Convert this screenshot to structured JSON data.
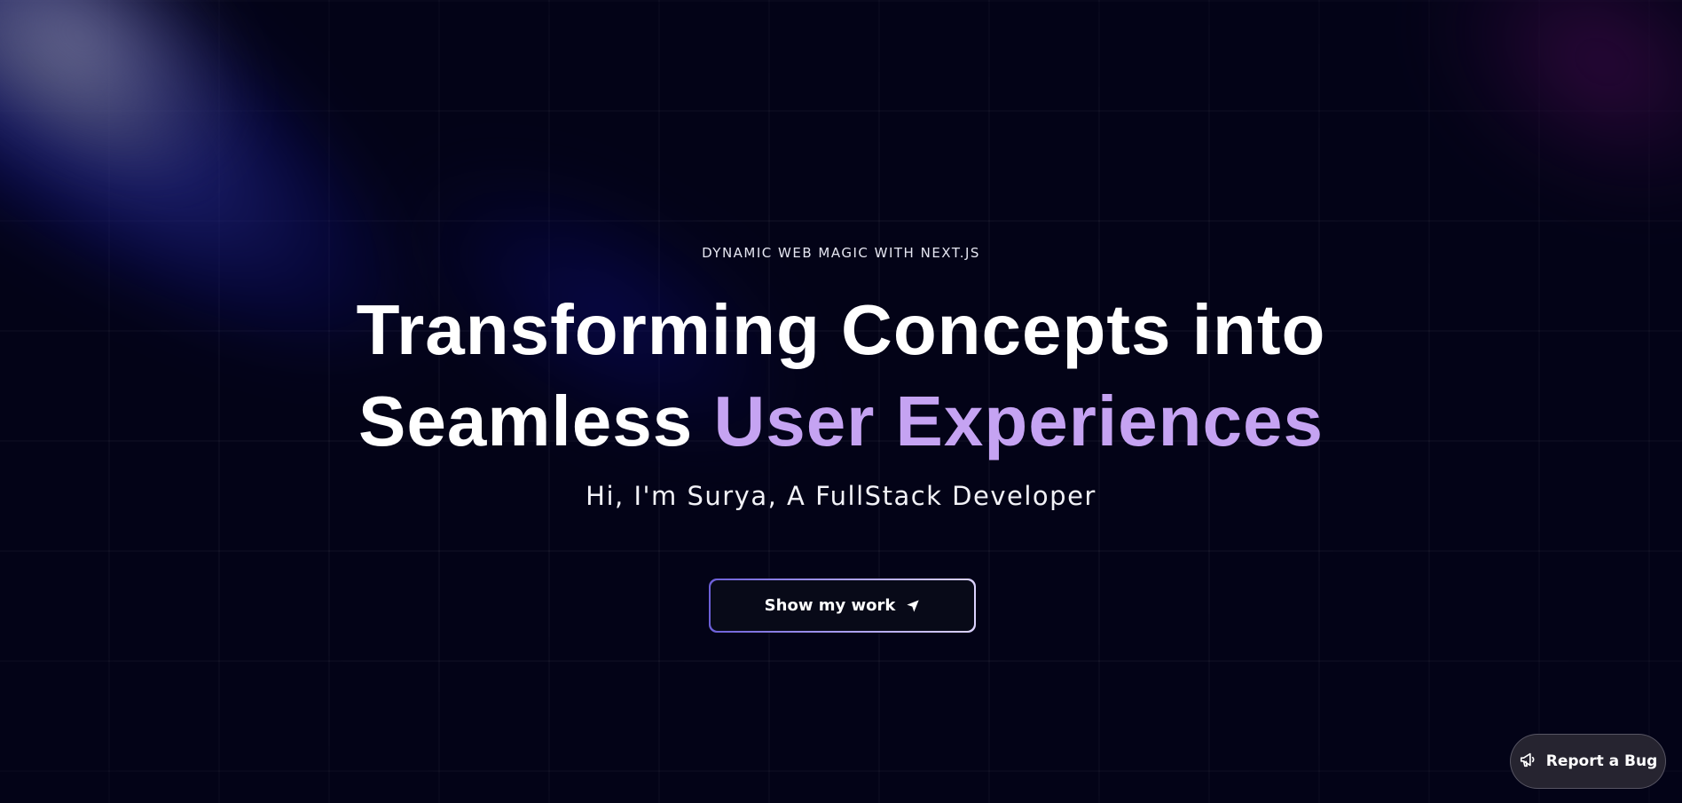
{
  "hero": {
    "eyebrow": "DYNAMIC WEB MAGIC WITH NEXT.JS",
    "headline_line1": "Transforming Concepts into",
    "headline_line2_plain": "Seamless ",
    "headline_line2_accent": "User Experiences",
    "subtitle": "Hi, I'm Surya, A FullStack Developer",
    "cta_label": "Show my work",
    "cta_icon": "send-arrow-icon"
  },
  "feedback": {
    "label": "Report a Bug",
    "icon": "megaphone-icon"
  },
  "colors": {
    "background": "#030317",
    "accent": "#c5a3f2",
    "text": "#ffffff",
    "cta_border_start": "#6c5fd8",
    "cta_border_end": "#dcd3ff"
  }
}
